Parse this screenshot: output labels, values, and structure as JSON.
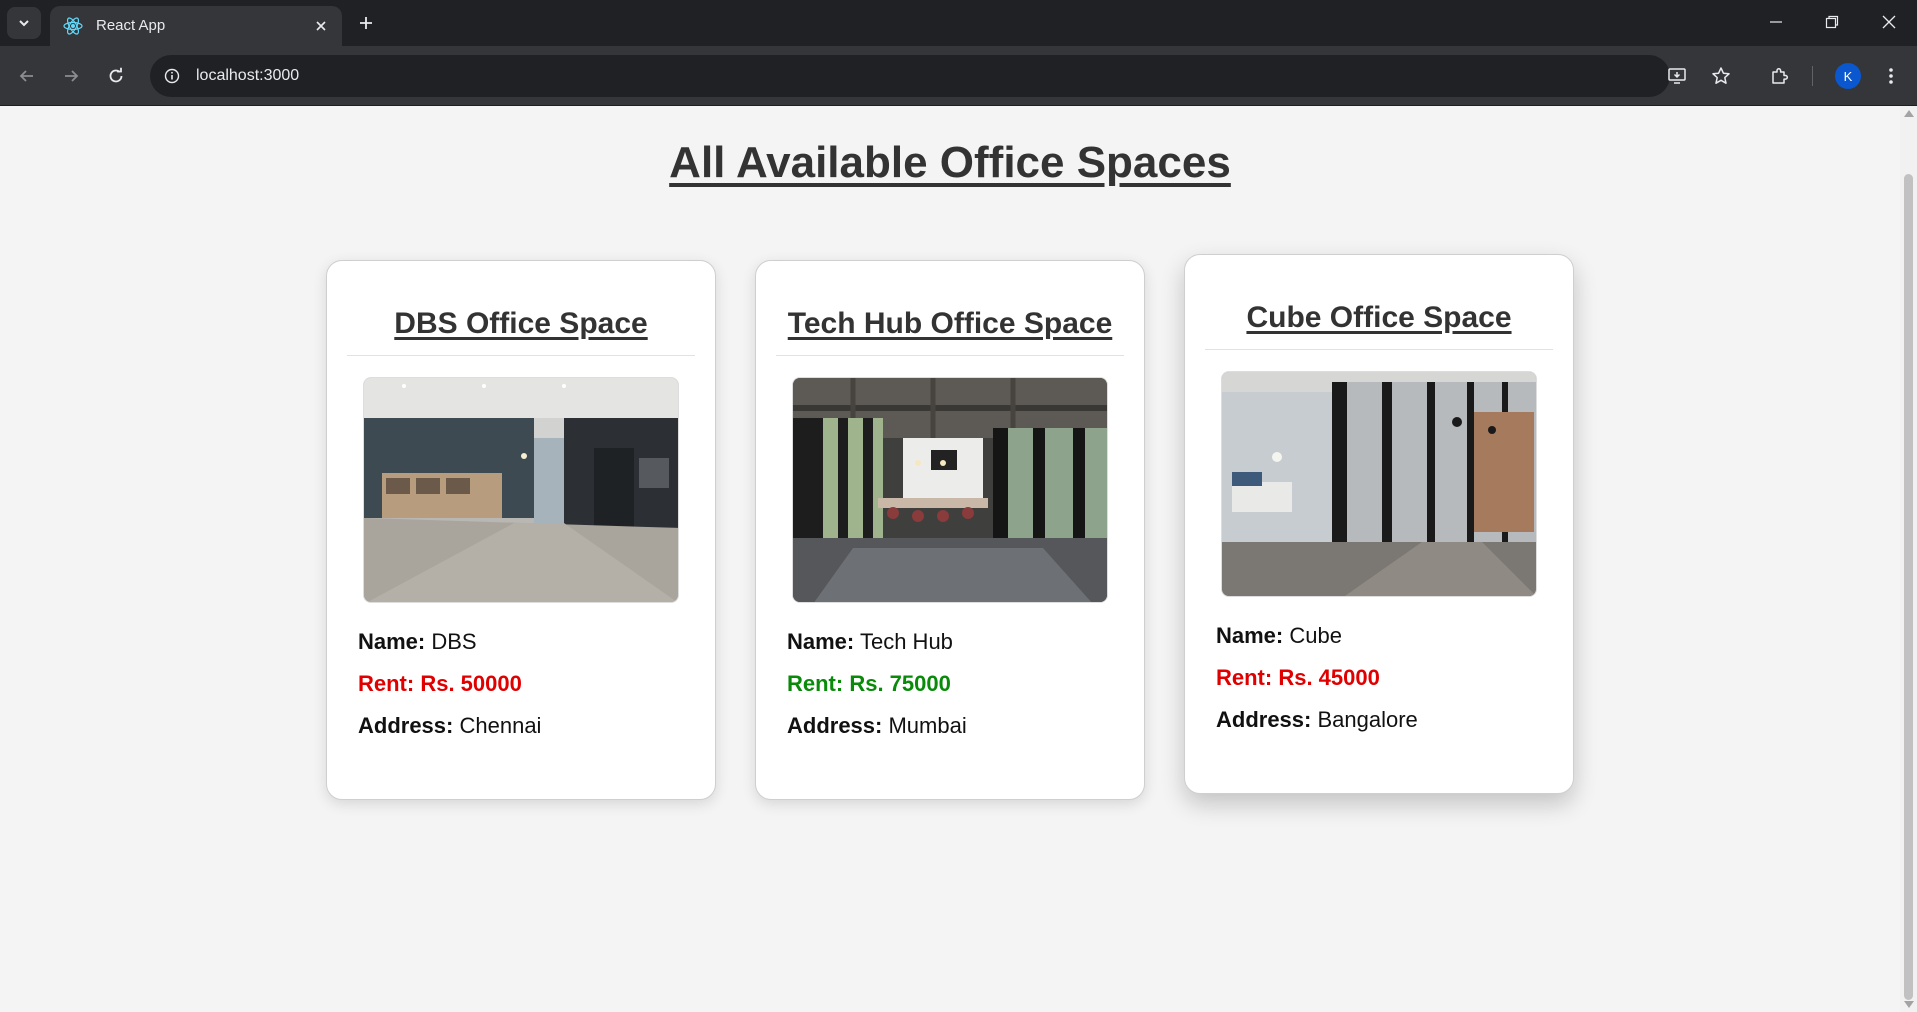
{
  "browser": {
    "tab_title": "React App",
    "url": "localhost:3000",
    "profile_initial": "K"
  },
  "page": {
    "title": "All Available Office Spaces"
  },
  "labels": {
    "name": "Name:",
    "address": "Address:"
  },
  "offices": [
    {
      "heading": "DBS Office Space",
      "name": "DBS",
      "rent": "Rent: Rs. 50000",
      "address": "Chennai",
      "rent_color": "#e00000"
    },
    {
      "heading": "Tech Hub Office Space",
      "name": "Tech Hub",
      "rent": "Rent: Rs. 75000",
      "address": "Mumbai",
      "rent_color": "#0a8a0a"
    },
    {
      "heading": "Cube Office Space",
      "name": "Cube",
      "rent": "Rent: Rs. 45000",
      "address": "Bangalore",
      "rent_color": "#e00000"
    }
  ]
}
